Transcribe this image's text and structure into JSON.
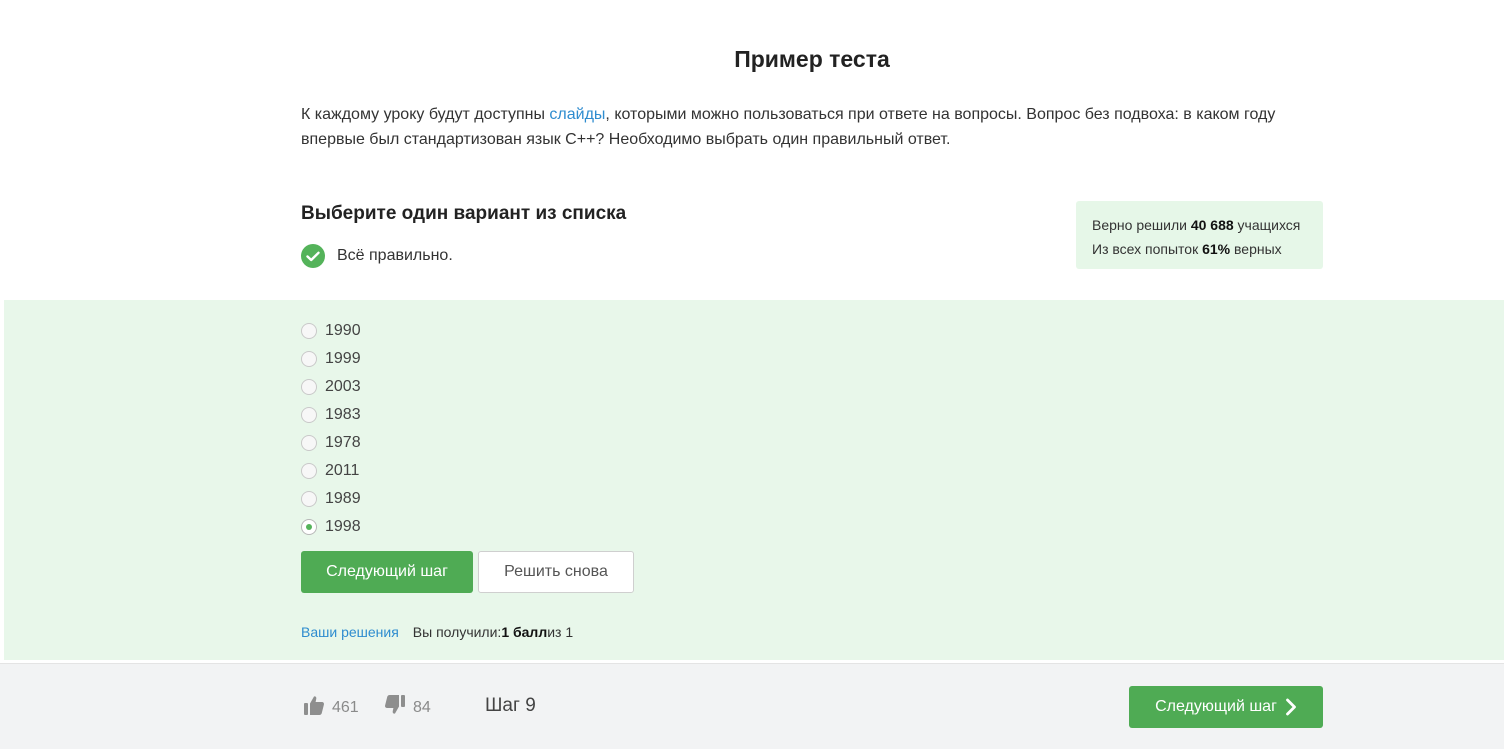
{
  "title": "Пример теста",
  "intro": {
    "before_link": "К каждому уроку будут доступны ",
    "link_text": "слайды",
    "after_link": ", которыми можно пользоваться при ответе на вопросы. Вопрос без подвоха: в каком году впервые был стандартизован язык С++? Необходимо выбрать один правильный ответ."
  },
  "question": {
    "heading": "Выберите один вариант из списка",
    "status_text": "Всё правильно."
  },
  "stats": {
    "solved_prefix": "Верно решили ",
    "solved_count": "40 688",
    "solved_suffix": " учащихся",
    "attempts_prefix": "Из всех попыток ",
    "attempts_percent": "61%",
    "attempts_suffix": " верных"
  },
  "options": [
    {
      "label": "1990",
      "checked": false
    },
    {
      "label": "1999",
      "checked": false
    },
    {
      "label": "2003",
      "checked": false
    },
    {
      "label": "1983",
      "checked": false
    },
    {
      "label": "1978",
      "checked": false
    },
    {
      "label": "2011",
      "checked": false
    },
    {
      "label": "1989",
      "checked": false
    },
    {
      "label": "1998",
      "checked": true
    }
  ],
  "buttons": {
    "next_step": "Следующий шаг",
    "retry": "Решить снова"
  },
  "result": {
    "solutions_link": "Ваши решения",
    "received_prefix": "Вы получили: ",
    "score": "1 балл",
    "score_suffix": " из 1"
  },
  "footer": {
    "likes": "461",
    "dislikes": "84",
    "step_label": "Шаг 9",
    "next_button": "Следующий шаг"
  },
  "colors": {
    "accent_green": "#4fab54",
    "answer_bg": "#e8f7ea",
    "link_blue": "#2e8ccf"
  }
}
